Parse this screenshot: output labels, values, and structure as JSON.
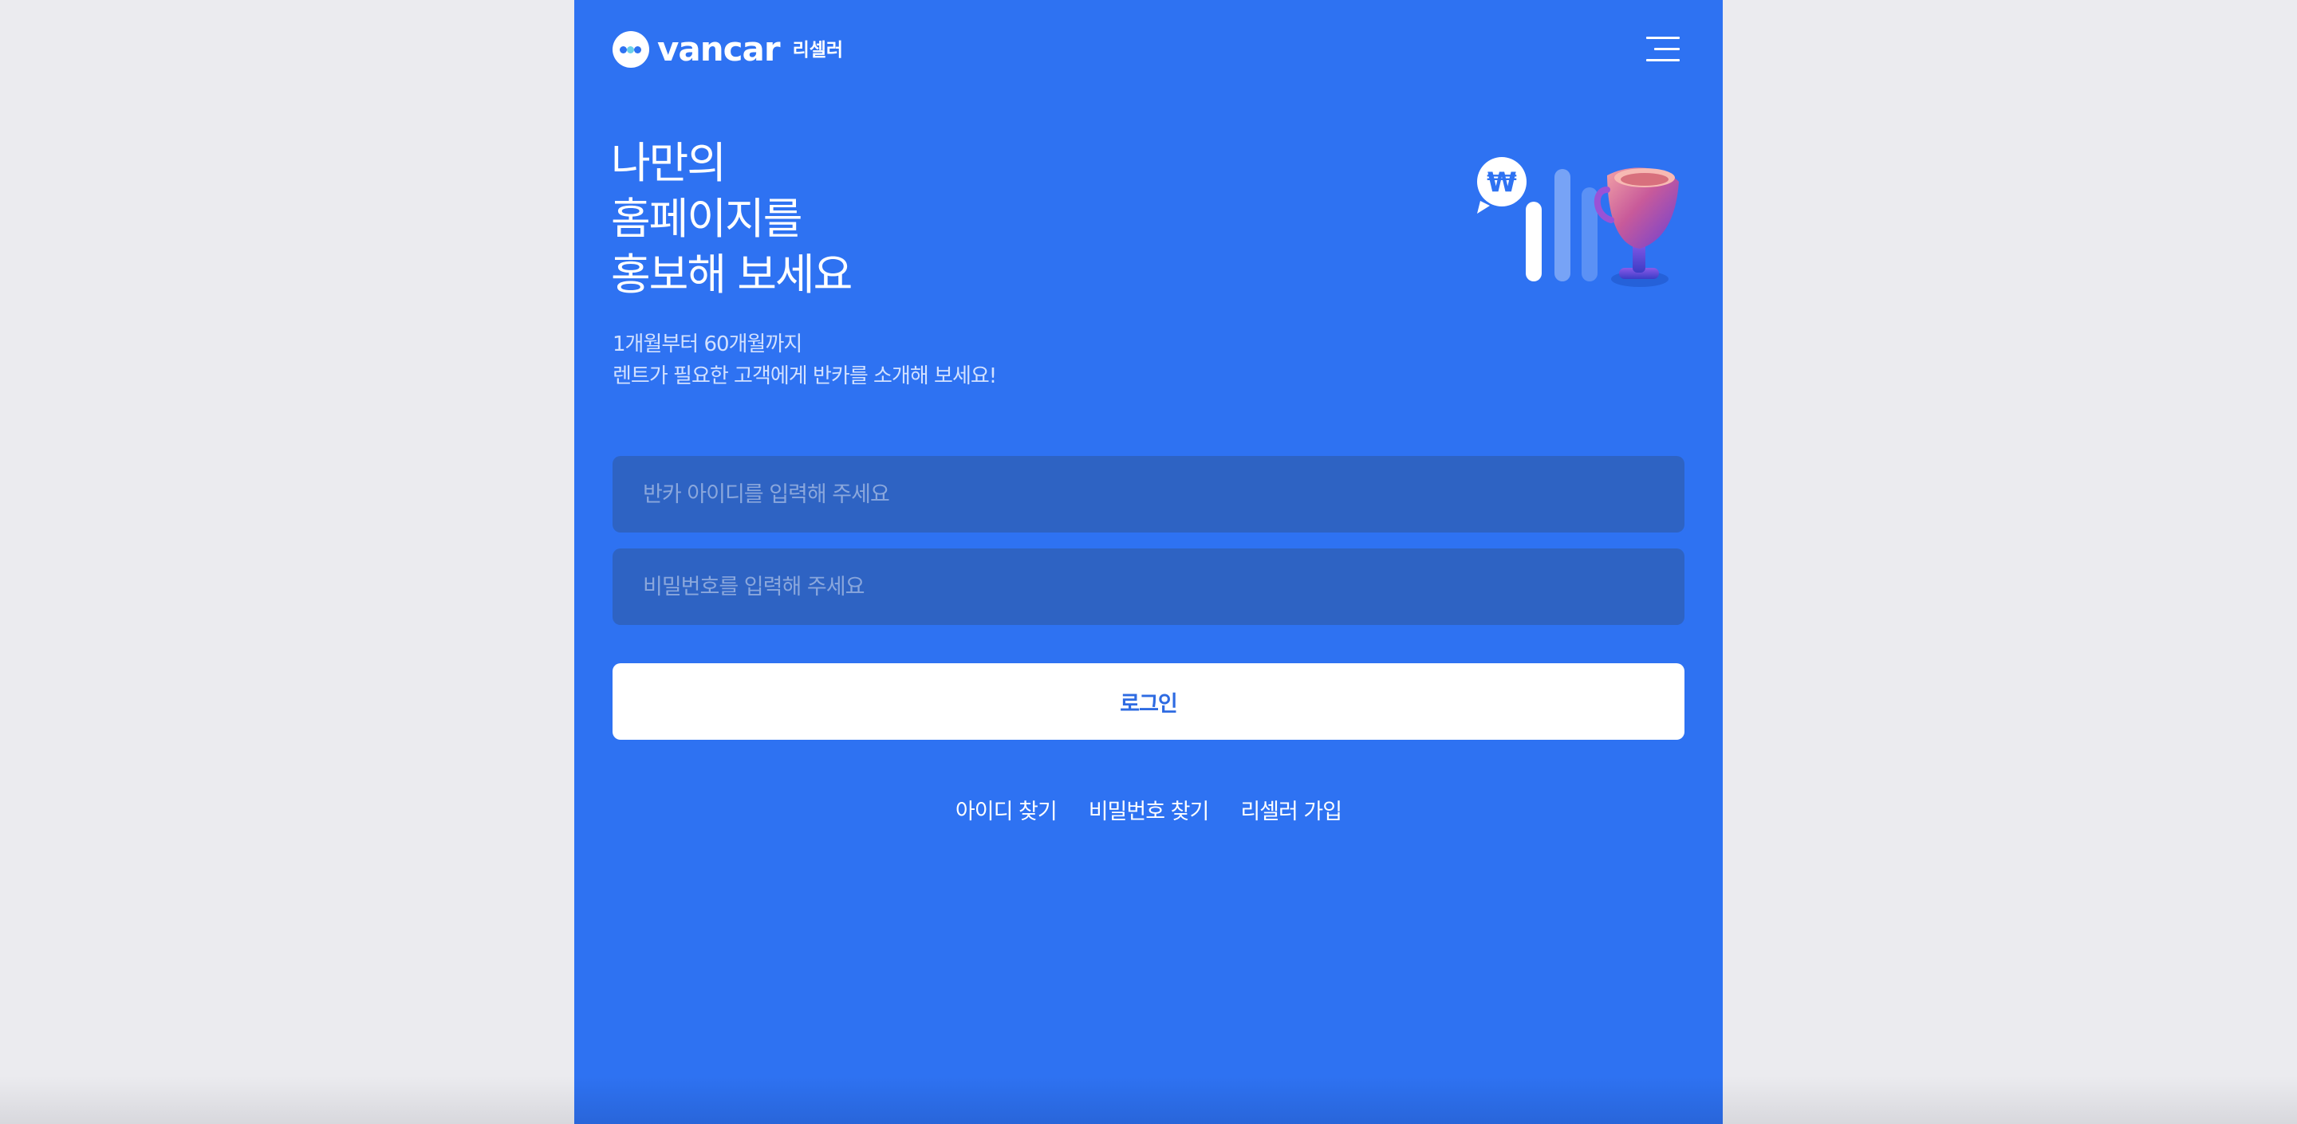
{
  "brand": {
    "wordmark": "vancar",
    "sub_label": "리셀러",
    "colors": {
      "primary": "#2e72f2",
      "input_background": "#2e63c3",
      "page_background": "#ebebef",
      "button_text": "#2e6be2"
    }
  },
  "header": {
    "menu_icon": "hamburger-menu-icon"
  },
  "hero": {
    "title_lines": [
      "나만의",
      "홈페이지를",
      "홍보해 보세요"
    ],
    "subtitle_lines": [
      "1개월부터 60개월까지",
      "렌트가 필요한 고객에게 반카를 소개해 보세요!"
    ],
    "illustration": {
      "currency_symbol": "₩",
      "icons": [
        "won-coin-icon",
        "bar-graph-icon",
        "trophy-icon"
      ]
    }
  },
  "form": {
    "id_placeholder": "반카 아이디를 입력해 주세요",
    "password_placeholder": "비밀번호를 입력해 주세요",
    "id_value": "",
    "password_value": "",
    "login_label": "로그인"
  },
  "links": {
    "find_id": "아이디 찾기",
    "find_password": "비밀번호 찾기",
    "signup": "리셀러 가입"
  }
}
